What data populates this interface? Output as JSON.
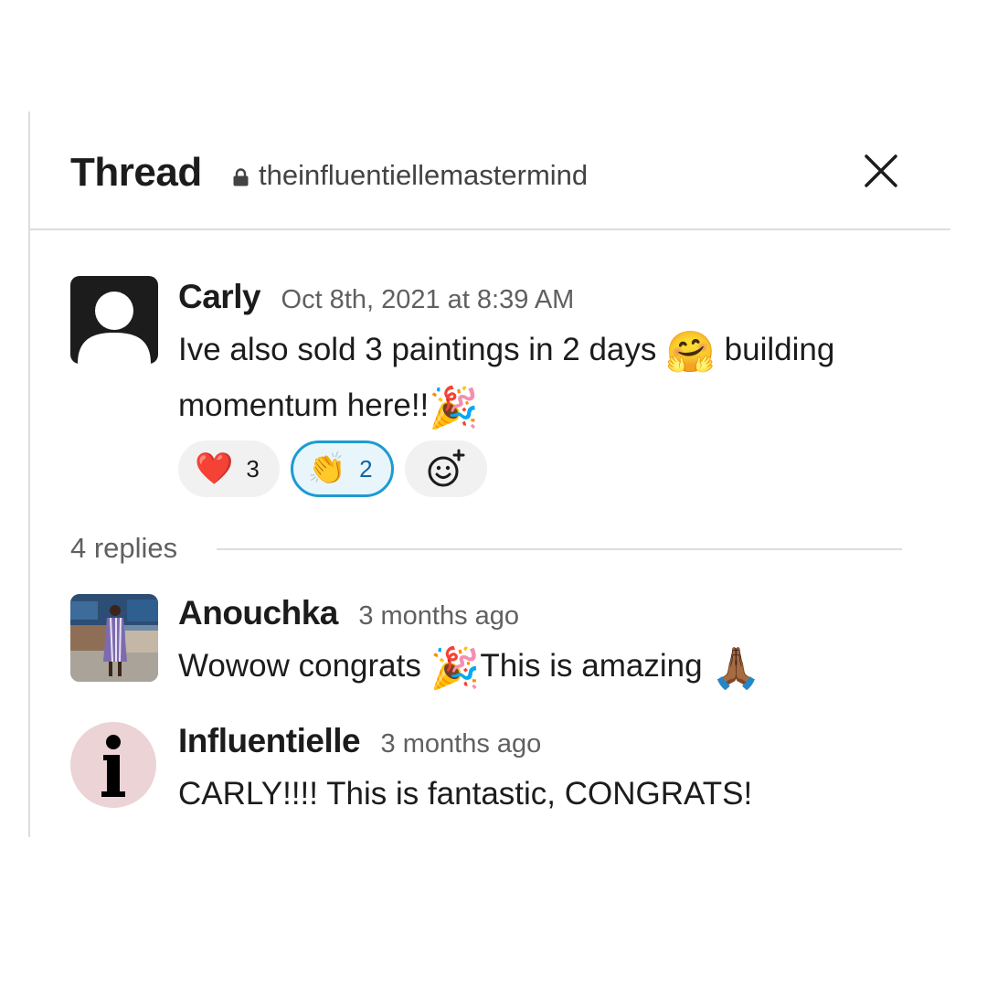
{
  "header": {
    "title": "Thread",
    "channel": "theinfluentiellemastermind"
  },
  "parent_message": {
    "author": "Carly",
    "timestamp": "Oct 8th, 2021 at 8:39 AM",
    "line1_text": "Ive also sold 3 paintings in 2 days",
    "line1_emoji": "🤗",
    "line1_after": "building",
    "line2_text": "momentum here!!",
    "line2_emoji": "🎉",
    "reactions": [
      {
        "emoji": "❤️",
        "count": "3",
        "active": false
      },
      {
        "emoji": "👏",
        "count": "2",
        "active": true
      }
    ]
  },
  "replies_label": "4 replies",
  "replies": [
    {
      "author": "Anouchka",
      "timestamp": "3 months ago",
      "text_before": "Wowow congrats",
      "emoji1": "🎉",
      "text_after": "This is amazing",
      "emoji2": "🙏🏾"
    },
    {
      "author": "Influentielle",
      "timestamp": "3 months ago",
      "text": "CARLY!!!! This is fantastic, CONGRATS!",
      "avatar_letter": "i"
    }
  ],
  "colors": {
    "accent": "#1d9bd1",
    "avatar_pink": "#ecd3d5"
  }
}
